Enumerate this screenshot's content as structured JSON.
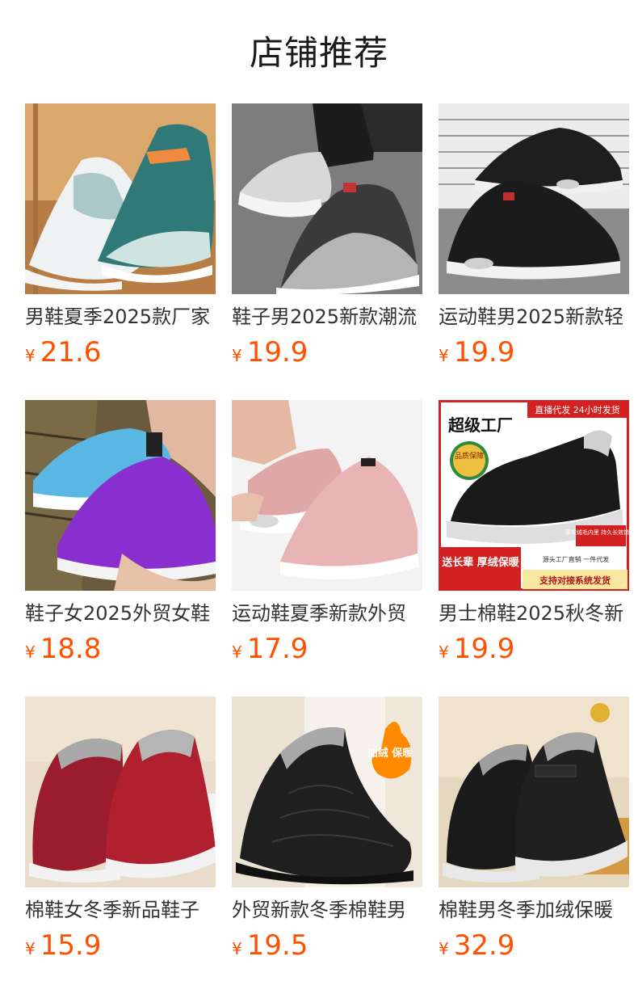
{
  "page": {
    "title": "店铺推荐"
  },
  "currency": "¥",
  "accent_color": "#ff5000",
  "products": [
    {
      "name": "男鞋夏季2025款厂家",
      "price": "21.6",
      "image": "white-teal-knit-sneaker"
    },
    {
      "name": "鞋子男2025新款潮流",
      "price": "19.9",
      "image": "gray-black-gradient-sneaker"
    },
    {
      "name": "运动鞋男2025新款轻",
      "price": "19.9",
      "image": "black-air-cushion-sneaker"
    },
    {
      "name": "鞋子女2025外贸女鞋",
      "price": "18.8",
      "image": "purple-blue-sneaker"
    },
    {
      "name": "运动鞋夏季新款外贸",
      "price": "17.9",
      "image": "pink-knit-sneaker"
    },
    {
      "name": "男士棉鞋2025秋冬新",
      "price": "19.9",
      "image": "black-fur-lined-slip-on",
      "badges": {
        "top": "直播代发 24小时发货",
        "headline": "超级工厂",
        "seal": "品质保障",
        "left_banner": "送长辈 厚绒保暖",
        "bottom_right": "支持对接系统发货",
        "fur_tag": "厚实绒毛内里 持久长效锁温",
        "source_tag": "源头工厂直销 一件代发"
      }
    },
    {
      "name": "棉鞋女冬季新品鞋子",
      "price": "15.9",
      "image": "red-fur-lined-boot"
    },
    {
      "name": "外贸新款冬季棉鞋男",
      "price": "19.5",
      "image": "black-quilted-snow-boot",
      "badges": {
        "flame": "加绒 保暖"
      }
    },
    {
      "name": "棉鞋男冬季加绒保暖",
      "price": "32.9",
      "image": "black-leather-velcro-boot"
    }
  ]
}
